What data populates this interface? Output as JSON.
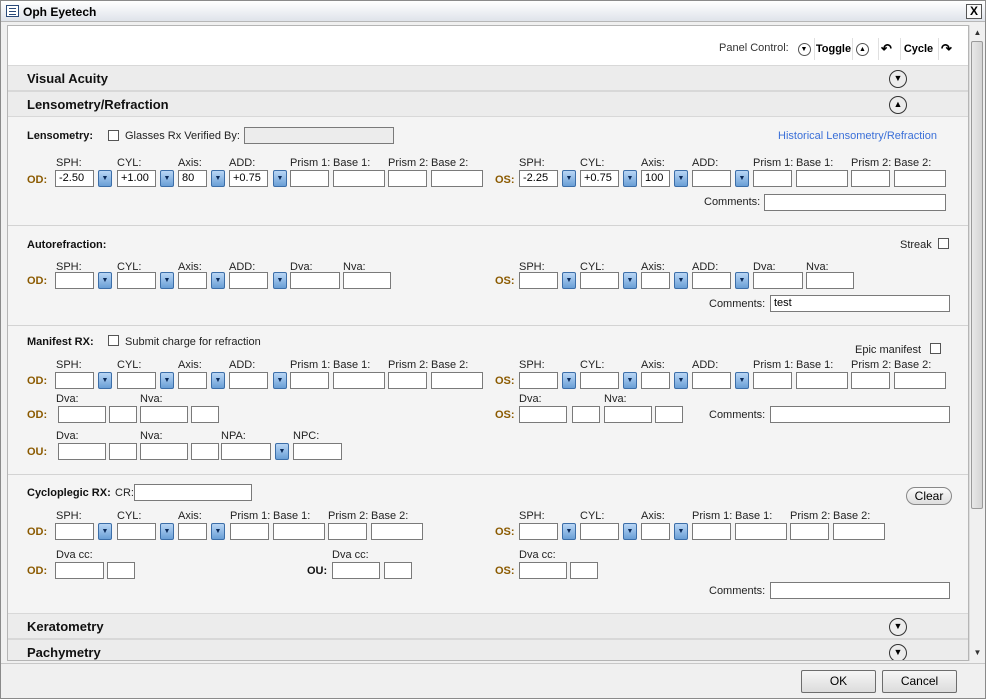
{
  "window": {
    "title": "Oph Eyetech",
    "close": "X"
  },
  "panel_control": {
    "label": "Panel Control:",
    "toggle": "Toggle",
    "cycle": "Cycle"
  },
  "sections": {
    "visual_acuity": "Visual Acuity",
    "lensometry_refraction": "Lensometry/Refraction",
    "keratometry": "Keratometry",
    "pachymetry": "Pachymetry"
  },
  "labels": {
    "sph": "SPH:",
    "cyl": "CYL:",
    "axis": "Axis:",
    "add": "ADD:",
    "prism1": "Prism 1:",
    "base1": "Base 1:",
    "prism2": "Prism 2:",
    "base2": "Base 2:",
    "dva": "Dva:",
    "nva": "Nva:",
    "npa": "NPA:",
    "npc": "NPC:",
    "dva_cc": "Dva cc:",
    "comments": "Comments:",
    "od": "OD:",
    "os": "OS:",
    "ou": "OU:"
  },
  "lensometry": {
    "title": "Lensometry:",
    "glasses_verified": "Glasses Rx Verified By:",
    "historical_link": "Historical Lensometry/Refraction",
    "od": {
      "sph": "-2.50",
      "cyl": "+1.00",
      "axis": "80",
      "add": "+0.75"
    },
    "os": {
      "sph": "-2.25",
      "cyl": "+0.75",
      "axis": "100",
      "add": ""
    }
  },
  "autorefraction": {
    "title": "Autorefraction:",
    "streak": "Streak",
    "comments": "test"
  },
  "manifest": {
    "title": "Manifest RX:",
    "submit_charge": "Submit charge for refraction",
    "epic": "Epic manifest"
  },
  "cycloplegic": {
    "title": "Cycloplegic RX:",
    "cr": "CR:",
    "clear": "Clear"
  },
  "footer": {
    "ok": "OK",
    "cancel": "Cancel"
  }
}
